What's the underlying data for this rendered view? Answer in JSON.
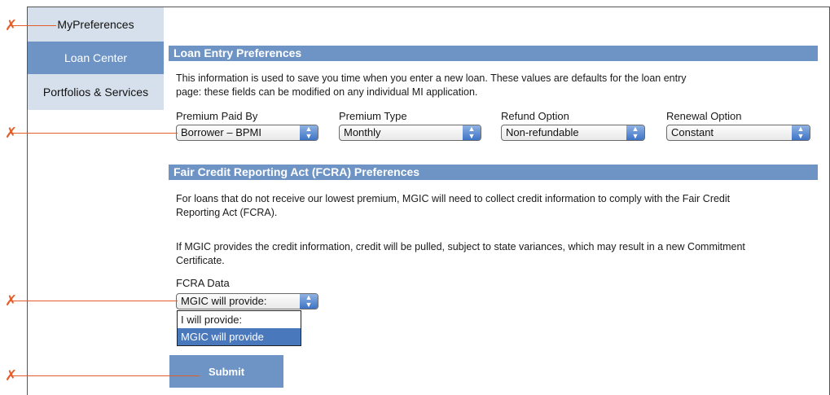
{
  "nav": {
    "items": [
      {
        "label": "MyPreferences"
      },
      {
        "label": "Loan Center"
      },
      {
        "label": "Portfolios & Services"
      }
    ]
  },
  "loan_entry": {
    "heading": "Loan Entry Preferences",
    "description_line1": "This information is used to save you time when you enter a new loan. These values are defaults for the loan entry",
    "description_line2": "page: these fields can be modified on any individual MI application.",
    "fields": [
      {
        "label": "Premium Paid By",
        "value": "Borrower – BPMI"
      },
      {
        "label": "Premium Type",
        "value": "Monthly"
      },
      {
        "label": "Refund Option",
        "value": "Non-refundable"
      },
      {
        "label": "Renewal Option",
        "value": "Constant"
      }
    ]
  },
  "fcra": {
    "heading": "Fair Credit Reporting Act (FCRA) Preferences",
    "para1_line1": "For loans that do not receive our lowest premium, MGIC will need to collect credit information to comply with the Fair Credit",
    "para1_line2": "Reporting Act (FCRA).",
    "para2_line1": "If MGIC provides the credit information, credit will be pulled, subject to state variances, which may result in a new Commitment",
    "para2_line2": "Certificate.",
    "field_label": "FCRA Data",
    "selected_value": "MGIC will provide:",
    "options": [
      {
        "label": "I will provide:"
      },
      {
        "label": "MGIC will provide"
      }
    ]
  },
  "submit_label": "Submit",
  "callout_glyph": "✗",
  "arrow_up": "▲",
  "arrow_down": "▼",
  "colors": {
    "section_bar": "#6d94c5",
    "nav_active": "#6d94c5",
    "nav_inactive": "#d6e0ec",
    "callout": "#e35d2a",
    "option_highlight": "#4a78bd"
  }
}
